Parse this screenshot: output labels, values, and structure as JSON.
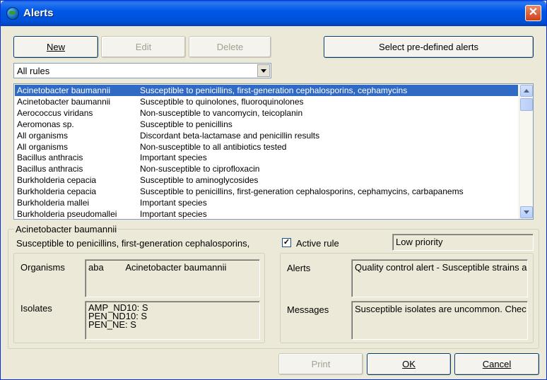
{
  "window": {
    "title": "Alerts",
    "close_symbol": "✕"
  },
  "toolbar": {
    "new_label": "New",
    "edit_label": "Edit",
    "delete_label": "Delete",
    "select_predefined_label": "Select pre-defined alerts"
  },
  "filter": {
    "selected": "All rules"
  },
  "rules": [
    {
      "organism": "Acinetobacter baumannii",
      "description": "Susceptible to penicillins, first-generation cephalosporins, cephamycins",
      "selected": true
    },
    {
      "organism": "Acinetobacter baumannii",
      "description": "Susceptible to quinolones, fluoroquinolones"
    },
    {
      "organism": "Aerococcus viridans",
      "description": "Non-susceptible to vancomycin, teicoplanin"
    },
    {
      "organism": "Aeromonas sp.",
      "description": "Susceptible to penicillins"
    },
    {
      "organism": "All organisms",
      "description": "Discordant beta-lactamase and penicillin results"
    },
    {
      "organism": "All organisms",
      "description": "Non-susceptible to all antibiotics tested"
    },
    {
      "organism": "Bacillus anthracis",
      "description": "Important species"
    },
    {
      "organism": "Bacillus anthracis",
      "description": "Non-susceptible to ciprofloxacin"
    },
    {
      "organism": "Burkholderia cepacia",
      "description": "Susceptible to aminoglycosides"
    },
    {
      "organism": "Burkholderia cepacia",
      "description": "Susceptible to penicillins, first-generation cephalosporins, cephamycins, carbapanems"
    },
    {
      "organism": "Burkholderia mallei",
      "description": "Important species"
    },
    {
      "organism": "Burkholderia pseudomallei",
      "description": "Important species"
    }
  ],
  "detail": {
    "organism_name": "Acinetobacter baumannii",
    "rule_description": "Susceptible to penicillins, first-generation cephalosporins,",
    "active_rule_label": "Active rule",
    "active_rule_checked": true,
    "priority_value": "Low priority",
    "organisms_label": "Organisms",
    "organism_code": "aba",
    "organism_full": "Acinetobacter baumannii",
    "isolates_label": "Isolates",
    "isolates": [
      "AMP_ND10:  S",
      "PEN_ND10:  S",
      "PEN_NE:  S"
    ],
    "alerts_label": "Alerts",
    "alerts_value": "Quality control alert - Susceptible strains ar",
    "messages_label": "Messages",
    "messages_value": "Susceptible isolates are uncommon.  Chec"
  },
  "footer": {
    "print_label": "Print",
    "ok_label": "OK",
    "cancel_label": "Cancel"
  }
}
